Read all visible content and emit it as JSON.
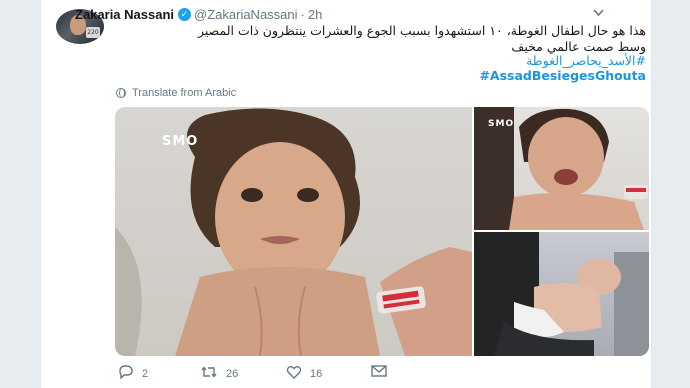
{
  "tweet": {
    "author_name": "Zakaria Nassani",
    "verified_label": "✓",
    "handle": "@ZakariaNassani",
    "separator": "·",
    "time": "2h",
    "avatar_badge": "220",
    "text_line1": "هذا هو حال اطفال الغوطة، ١٠ استشهدوا بسبب الجوع والعشرات ينتظرون ذات المصير",
    "text_line2": "وسط صمت عالمي مخيف",
    "hashtag_arabic": "#الأسد_يحاصر_الغوطة",
    "hashtag_english": "#AssadBesiegesGhouta",
    "translate_label": "Translate from Arabic",
    "media_watermarks": [
      "SMO",
      "SMO"
    ],
    "actions": {
      "replies": "2",
      "retweets": "26",
      "likes": "16"
    }
  },
  "icons": {
    "reply": "reply-icon",
    "retweet": "retweet-icon",
    "like": "heart-icon",
    "message": "envelope-icon",
    "more": "chevron-down-icon",
    "globe": "globe-icon"
  },
  "colors": {
    "link": "#1b95e0",
    "verified": "#1da1f2",
    "muted": "#657786"
  }
}
